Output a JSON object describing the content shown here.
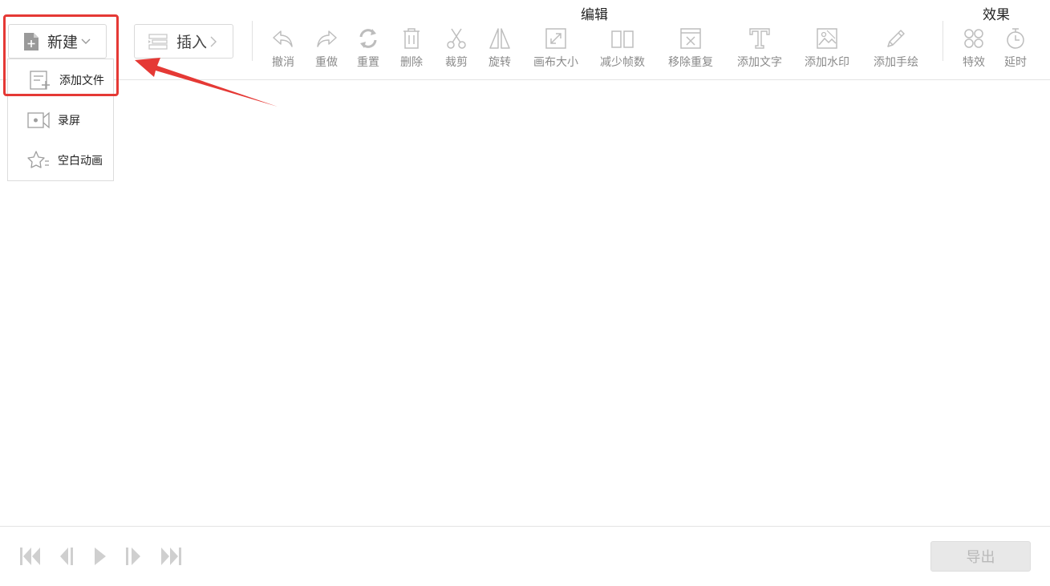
{
  "toolbar": {
    "new_label": "新建",
    "insert_label": "插入",
    "group_edit": "编辑",
    "group_effects": "效果",
    "tools": [
      {
        "label": "撤消",
        "icon": "undo-icon"
      },
      {
        "label": "重做",
        "icon": "redo-icon"
      },
      {
        "label": "重置",
        "icon": "reset-icon"
      },
      {
        "label": "删除",
        "icon": "trash-icon"
      },
      {
        "label": "裁剪",
        "icon": "scissors-icon"
      },
      {
        "label": "旋转",
        "icon": "rotate-icon"
      },
      {
        "label": "画布大小",
        "icon": "canvas-size-icon"
      },
      {
        "label": "减少帧数",
        "icon": "reduce-frames-icon"
      },
      {
        "label": "移除重复",
        "icon": "remove-duplicate-icon"
      },
      {
        "label": "添加文字",
        "icon": "text-icon"
      },
      {
        "label": "添加水印",
        "icon": "watermark-icon"
      },
      {
        "label": "添加手绘",
        "icon": "pencil-icon"
      }
    ],
    "effects": [
      {
        "label": "特效",
        "icon": "effects-icon"
      },
      {
        "label": "延时",
        "icon": "timer-icon"
      }
    ]
  },
  "new_menu": {
    "items": [
      {
        "label": "添加文件",
        "icon": "add-file-icon"
      },
      {
        "label": "录屏",
        "icon": "screen-record-icon"
      },
      {
        "label": "空白动画",
        "icon": "blank-animation-icon"
      }
    ]
  },
  "bottom": {
    "export_label": "导出"
  },
  "colors": {
    "highlight": "#e53935",
    "icon_gray": "#b5b5b5",
    "text_gray": "#8a8a8a"
  }
}
